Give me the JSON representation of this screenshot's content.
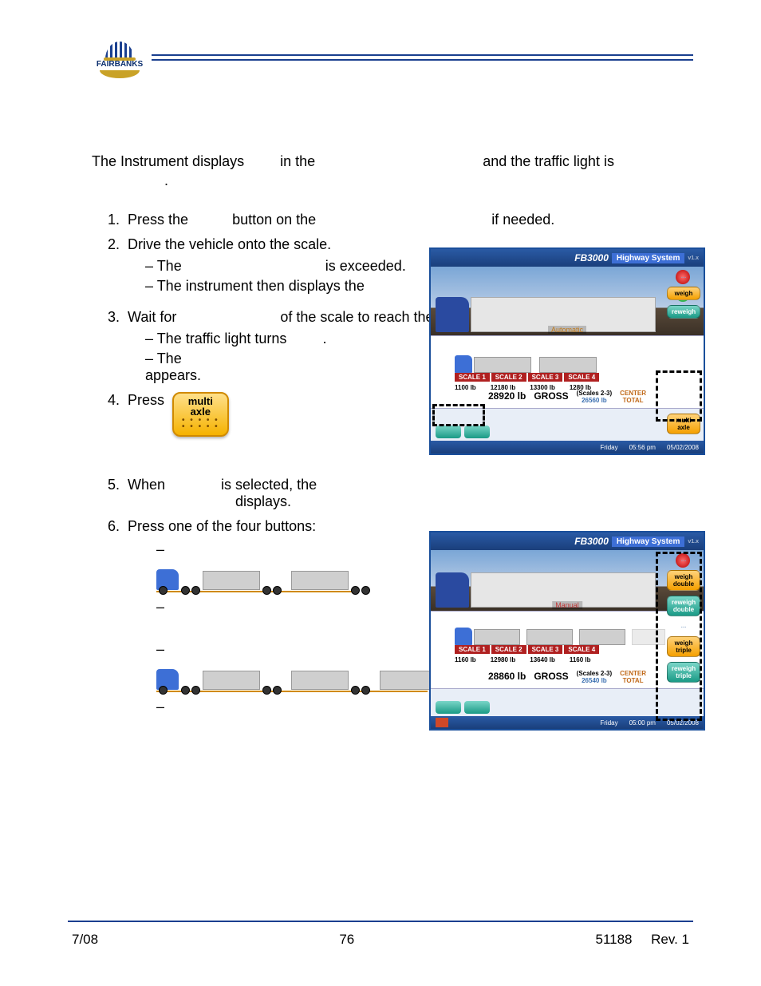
{
  "logo_text": "FAIRBANKS",
  "intro": {
    "t1": "The Instrument displays",
    "t2": "in the",
    "t3": "and the traffic light is",
    "t4": "."
  },
  "steps": {
    "s1": {
      "a": "Press the",
      "b": "button on the",
      "c": "if needed."
    },
    "s2": "Drive the vehicle onto the scale.",
    "s2_sub": {
      "a1": "The",
      "a2": "is exceeded.",
      "b": "The instrument then displays the"
    },
    "s3": {
      "a": "Wait for",
      "b": "of the scale to reach the"
    },
    "s3_sub": {
      "a1": "The traffic light turns",
      "a2": ".",
      "b1": "The",
      "b2": "appears."
    },
    "s4": "Press",
    "s5": {
      "a": "When",
      "b": "is selected, the",
      "c": "displays."
    },
    "s6": "Press one of the four buttons:"
  },
  "multi_axle_btn_l1": "multi",
  "multi_axle_btn_l2": "axle",
  "screenshots": {
    "common": {
      "fb": "FB3000",
      "hs": "Highway System",
      "gross": "GROSS",
      "center": "CENTER",
      "total": "TOTAL",
      "day": "Friday"
    },
    "s1": {
      "mode": "Automatic",
      "weight_main": "28920 lb",
      "weight_center": "26560 lb",
      "time": "05:56 pm",
      "date": "05/02/2008",
      "tabs": [
        "SCALE 1",
        "SCALE 2",
        "SCALE 3",
        "SCALE 4"
      ],
      "tab_vals": [
        "1100 lb",
        "12180 lb",
        "13300 lb",
        "1280 lb"
      ],
      "side": {
        "weigh": "weigh",
        "reweigh": "reweigh",
        "multi": "multi\naxle"
      }
    },
    "s2": {
      "mode": "Manual",
      "weight_main": "28860 lb",
      "weight_center": "26540 lb",
      "time": "05:00 pm",
      "date": "05/02/2008",
      "tabs": [
        "SCALE 1",
        "SCALE 2",
        "SCALE 3",
        "SCALE 4"
      ],
      "tab_vals": [
        "1160 lb",
        "12980 lb",
        "13640 lb",
        "1160 lb"
      ],
      "side": {
        "weigh_double": "weigh\ndouble",
        "reweigh_double": "reweigh\ndouble",
        "weigh_triple": "weigh\ntriple",
        "reweigh_triple": "reweigh\ntriple"
      }
    }
  },
  "footer": {
    "left": "7/08",
    "center": "76",
    "right": "51188     Rev. 1"
  }
}
